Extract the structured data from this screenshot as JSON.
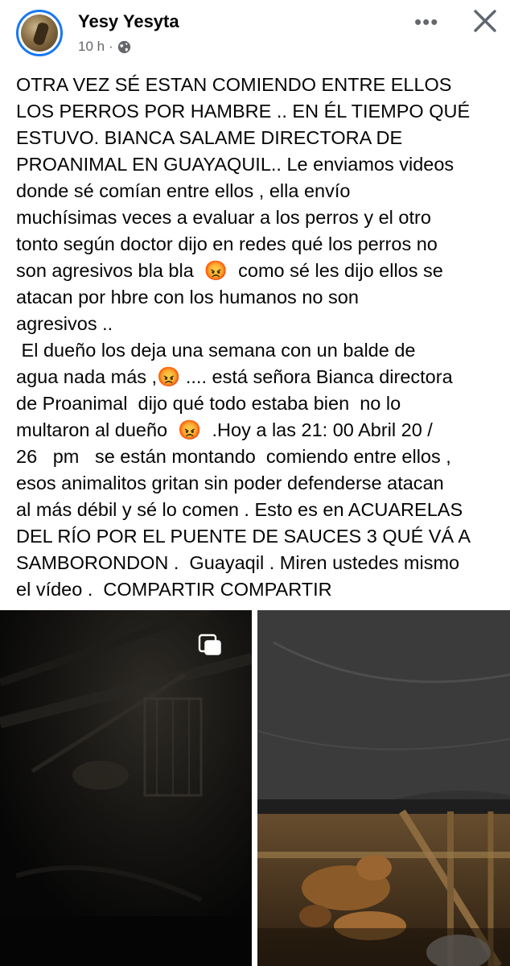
{
  "post": {
    "author": "Yesy Yesyta",
    "time": "10 h",
    "separator": "·",
    "audience_icon": "globe-icon",
    "more_label": "•••",
    "close_icon": "close-icon",
    "text": "OTRA VEZ SÉ ESTAN COMIENDO ENTRE ELLOS\nLOS PERROS POR HAMBRE .. EN ÉL TIEMPO QUÉ\nESTUVO. BIANCA SALAME DIRECTORA DE\nPROANIMAL EN GUAYAQUIL.. Le enviamos videos\ndonde sé comían entre ellos , ella envío\nmuchísimas veces a evaluar a los perros y el otro\ntonto según doctor dijo en redes qué los perros no\nson agresivos bla bla  😡  como sé les dijo ellos se\natacan por hbre con los humanos no son\nagresivos ..\n El dueño los deja una semana con un balde de\nagua nada más ,😡 .... está señora Bianca directora\nde Proanimal  dijo qué todo estaba bien  no lo\nmultaron al dueño  😡  .Hoy a las 21: 00 Abril 20 /\n26   pm   se están montando  comiendo entre ellos ,\nesos animalitos gritan sin poder defenderse atacan\nal más débil y sé lo comen . Esto es en ACUARELAS\nDEL RÍO POR EL PUENTE DE SAUCES 3 QUÉ VÁ A\nSAMBORONDON .  Guayaqil . Miren ustedes mismo\nel vídeo .  COMPARTIR COMPARTIR",
    "media": {
      "left_overlay_icon": "multiple-media-icon",
      "left_kind": "dark night photo",
      "right_kind": "dogs under tarp photo"
    }
  }
}
